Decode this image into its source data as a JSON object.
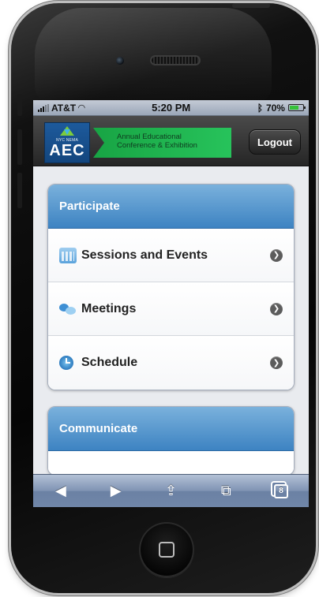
{
  "status_bar": {
    "carrier": "AT&T",
    "time": "5:20 PM",
    "battery": "70%",
    "battery_level": 0.7
  },
  "header": {
    "logo_small": "NYC NEMA",
    "logo_text": "AEC",
    "banner_line1": "Annual Educational",
    "banner_line2": "Conference & Exhibition",
    "logout_label": "Logout"
  },
  "sections": [
    {
      "title": "Participate",
      "items": [
        {
          "label": "Sessions and Events",
          "icon": "calendar-icon"
        },
        {
          "label": "Meetings",
          "icon": "meetings-icon"
        },
        {
          "label": "Schedule",
          "icon": "clock-icon"
        }
      ]
    },
    {
      "title": "Communicate",
      "items": []
    }
  ],
  "toolbar": {
    "back_icon": "◀",
    "forward_icon": "▶",
    "share_icon": "⇪",
    "bookmarks_icon": "⧉",
    "tabs_count": "8"
  },
  "colors": {
    "section_header": "#3d83c2",
    "banner_green": "#18a444",
    "logo_blue": "#1d5a9c"
  }
}
